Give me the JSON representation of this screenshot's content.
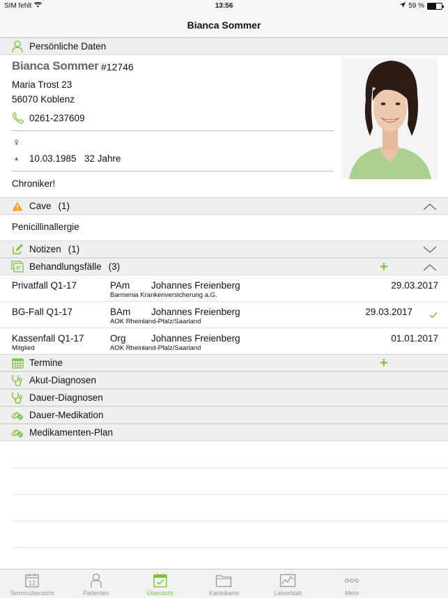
{
  "status_bar": {
    "carrier": "SIM fehlt",
    "time": "13:56",
    "battery": "59 %",
    "battery_level": 0.59
  },
  "nav": {
    "title": "Bianca Sommer"
  },
  "personal": {
    "header": "Persönliche Daten",
    "name": "Bianca Sommer",
    "patient_id": "#12746",
    "street": "Maria Trost 23",
    "city": "56070 Koblenz",
    "phone": "0261-237609",
    "gender_symbol": "♀",
    "birth_symbol": "*",
    "birth_date": "10.03.1985",
    "age": "32 Jahre",
    "note": "Chroniker!"
  },
  "cave": {
    "label": "Cave",
    "count": "(1)",
    "text": "Penicillinallergie"
  },
  "notes": {
    "label": "Notizen",
    "count": "(1)"
  },
  "cases": {
    "label": "Behandlungsfälle",
    "count": "(3)",
    "rows": [
      {
        "name": "Privatfall Q1-17",
        "sub": "",
        "code": "PAm",
        "doctor": "Johannes Freienberg",
        "insurance": "Barmenia Krankenversicherung a.G.",
        "date": "29.03.2017",
        "checked": false
      },
      {
        "name": "BG-Fall Q1-17",
        "sub": "",
        "code": "BAm",
        "doctor": "Johannes Freienberg",
        "insurance": "AOK Rheinland-Pfalz/Saarland",
        "date": "29.03.2017",
        "checked": true
      },
      {
        "name": "Kassenfall Q1-17",
        "sub": "Mitglied",
        "code": "Org",
        "doctor": "Johannes Freienberg",
        "insurance": "AOK Rheinland-Pfalz/Saarland",
        "date": "01.01.2017",
        "checked": false
      }
    ]
  },
  "sections": {
    "termine": "Termine",
    "akut": "Akut-Diagnosen",
    "dauer": "Dauer-Diagnosen",
    "medikation": "Dauer-Medikation",
    "plan": "Medikamenten-Plan"
  },
  "tabs": [
    {
      "label": "Terminübersicht",
      "icon": "calendar-icon",
      "active": false,
      "day": "12"
    },
    {
      "label": "Patienten",
      "icon": "person-icon",
      "active": false
    },
    {
      "label": "Übersicht",
      "icon": "calendar-check-icon",
      "active": true
    },
    {
      "label": "Karteikarte",
      "icon": "folder-icon",
      "active": false
    },
    {
      "label": "Laborblatt",
      "icon": "chart-icon",
      "active": false
    },
    {
      "label": "Mehr",
      "icon": "more-icon",
      "active": false
    }
  ],
  "colors": {
    "accent": "#7cc243",
    "warning": "#f0a01e",
    "header_bg": "#efefef"
  }
}
